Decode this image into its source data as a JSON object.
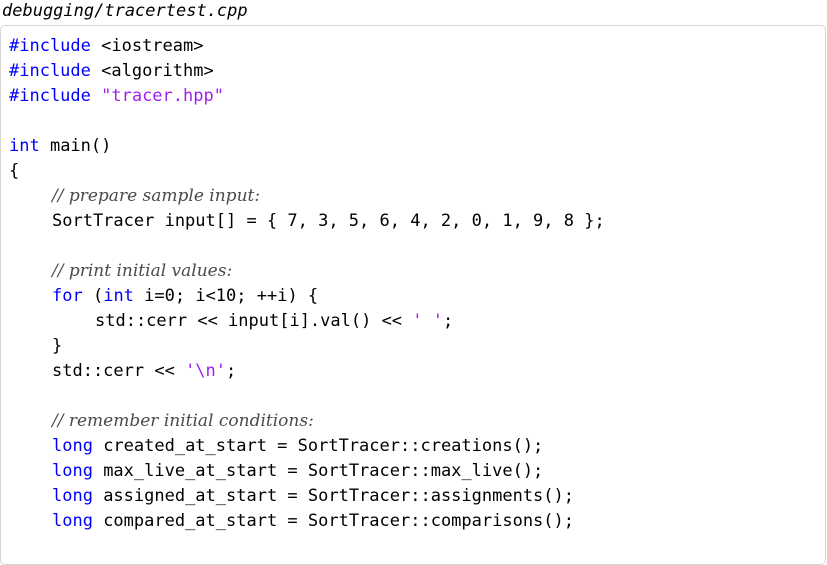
{
  "file": {
    "name": "debugging/tracertest.cpp"
  },
  "code": {
    "inc1_kw": "#include",
    "inc1_rest": " <iostream>",
    "inc2_kw": "#include",
    "inc2_rest": " <algorithm>",
    "inc3_kw": "#include",
    "inc3_str": " \"tracer.hpp\"",
    "main_kw": "int",
    "main_rest": " main()",
    "brace_open": "{",
    "c1": "// prepare sample input:",
    "sample_input": "SortTracer input[] = { 7, 3, 5, 6, 4, 2, 0, 1, 9, 8 };",
    "c2": "// print initial values:",
    "for_kw": "for",
    "for_p1": " (",
    "for_int": "int",
    "for_rest": " i=0; i<10; ++i) {",
    "cerr1": "std::cerr << input[i].val() << ",
    "space_lit": "' '",
    "cerr1_end": ";",
    "brace_close_inner": "}",
    "cerr2": "std::cerr << ",
    "newline_lit": "'\\n'",
    "cerr2_end": ";",
    "c3": "// remember initial conditions:",
    "long1_kw": "long",
    "long1_rest": " created_at_start = SortTracer::creations();",
    "long2_kw": "long",
    "long2_rest": " max_live_at_start = SortTracer::max_live();",
    "long3_kw": "long",
    "long3_rest": " assigned_at_start = SortTracer::assignments();",
    "long4_kw": "long",
    "long4_rest": " compared_at_start = SortTracer::comparisons();"
  },
  "colors": {
    "keyword": "#0000ff",
    "string": "#a020f0",
    "comment": "#4a4a4a"
  }
}
